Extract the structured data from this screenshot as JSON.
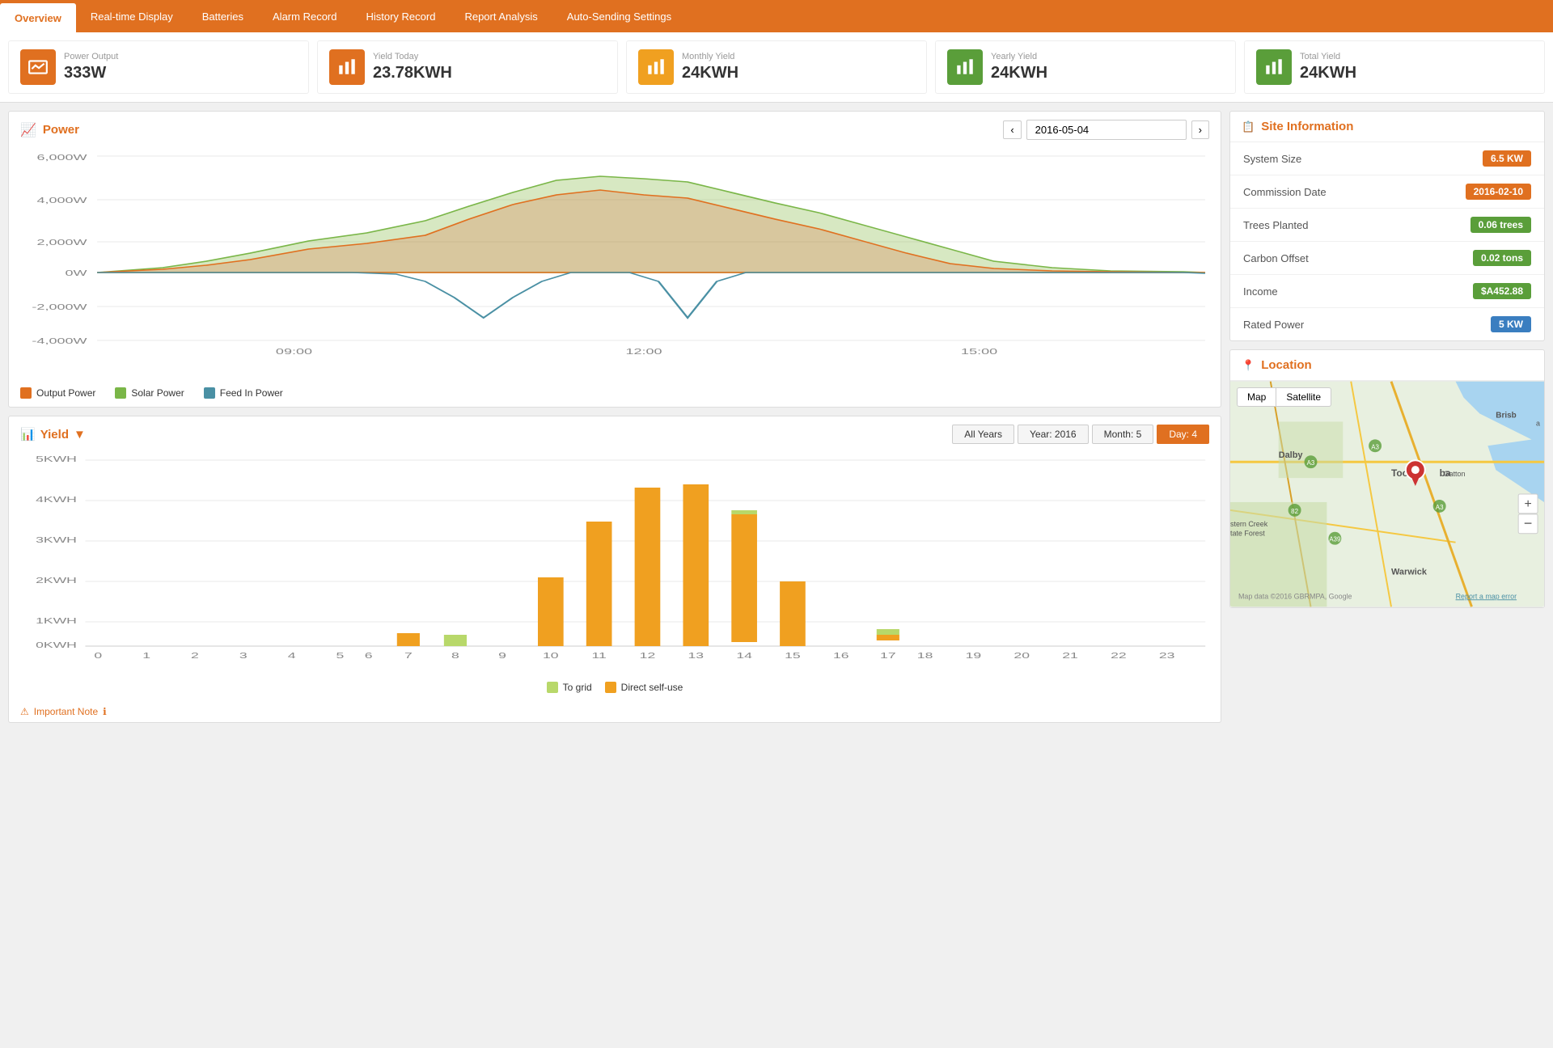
{
  "nav": {
    "items": [
      {
        "label": "Overview",
        "active": true
      },
      {
        "label": "Real-time Display",
        "active": false
      },
      {
        "label": "Batteries",
        "active": false
      },
      {
        "label": "Alarm Record",
        "active": false
      },
      {
        "label": "History Record",
        "active": false
      },
      {
        "label": "Report Analysis",
        "active": false
      },
      {
        "label": "Auto-Sending Settings",
        "active": false
      }
    ]
  },
  "stats": [
    {
      "label": "Power Output",
      "value": "333W",
      "color": "#e07020",
      "icon": "chart"
    },
    {
      "label": "Yield Today",
      "value": "23.78KWH",
      "color": "#e07020",
      "icon": "bar"
    },
    {
      "label": "Monthly Yield",
      "value": "24KWH",
      "color": "#f0a020",
      "icon": "bar"
    },
    {
      "label": "Yearly Yield",
      "value": "24KWH",
      "color": "#5a9e3a",
      "icon": "bar"
    },
    {
      "label": "Total Yield",
      "value": "24KWH",
      "color": "#5a9e3a",
      "icon": "bar"
    }
  ],
  "power": {
    "title": "Power",
    "date": "2016-05-04",
    "legend": [
      {
        "label": "Output Power",
        "color": "#e07020"
      },
      {
        "label": "Solar Power",
        "color": "#7ab648"
      },
      {
        "label": "Feed In Power",
        "color": "#4a90a4"
      }
    ]
  },
  "yield": {
    "title": "Yield",
    "tabs": [
      {
        "label": "All Years"
      },
      {
        "label": "Year: 2016"
      },
      {
        "label": "Month: 5"
      },
      {
        "label": "Day: 4",
        "active": true
      }
    ],
    "legend": [
      {
        "label": "To grid",
        "color": "#b8d86a"
      },
      {
        "label": "Direct self-use",
        "color": "#f0a020"
      }
    ],
    "bars": [
      {
        "hour": 0,
        "grid": 0,
        "self": 0
      },
      {
        "hour": 1,
        "grid": 0,
        "self": 0
      },
      {
        "hour": 2,
        "grid": 0,
        "self": 0
      },
      {
        "hour": 3,
        "grid": 0,
        "self": 0
      },
      {
        "hour": 4,
        "grid": 0,
        "self": 0
      },
      {
        "hour": 5,
        "grid": 0,
        "self": 0
      },
      {
        "hour": 6,
        "grid": 0,
        "self": 0
      },
      {
        "hour": 7,
        "grid": 0.35,
        "self": 0
      },
      {
        "hour": 8,
        "grid": 0.3,
        "self": 0
      },
      {
        "hour": 9,
        "grid": 0,
        "self": 0
      },
      {
        "hour": 10,
        "grid": 0,
        "self": 1.85
      },
      {
        "hour": 11,
        "grid": 0,
        "self": 3.35
      },
      {
        "hour": 12,
        "grid": 0,
        "self": 4.25
      },
      {
        "hour": 13,
        "grid": 0,
        "self": 4.35
      },
      {
        "hour": 14,
        "grid": 0.1,
        "self": 3.55
      },
      {
        "hour": 15,
        "grid": 0,
        "self": 1.75
      },
      {
        "hour": 16,
        "grid": 0,
        "self": 0
      },
      {
        "hour": 17,
        "grid": 0.15,
        "self": 0.15
      },
      {
        "hour": 18,
        "grid": 0,
        "self": 0
      },
      {
        "hour": 19,
        "grid": 0,
        "self": 0
      },
      {
        "hour": 20,
        "grid": 0,
        "self": 0
      },
      {
        "hour": 21,
        "grid": 0,
        "self": 0
      },
      {
        "hour": 22,
        "grid": 0,
        "self": 0
      },
      {
        "hour": 23,
        "grid": 0,
        "self": 0
      }
    ]
  },
  "siteInfo": {
    "title": "Site Information",
    "rows": [
      {
        "key": "System Size",
        "value": "6.5 KW",
        "badgeColor": "#e07020"
      },
      {
        "key": "Commission Date",
        "value": "2016-02-10",
        "badgeColor": "#e07020"
      },
      {
        "key": "Trees Planted",
        "value": "0.06 trees",
        "badgeColor": "#5a9e3a"
      },
      {
        "key": "Carbon Offset",
        "value": "0.02 tons",
        "badgeColor": "#5a9e3a"
      },
      {
        "key": "Income",
        "value": "$A452.88",
        "badgeColor": "#5a9e3a"
      },
      {
        "key": "Rated Power",
        "value": "5 KW",
        "badgeColor": "#3a7ec0"
      }
    ]
  },
  "location": {
    "title": "Location",
    "mapTabs": [
      "Map",
      "Satellite"
    ]
  },
  "importantNote": "Important Note"
}
